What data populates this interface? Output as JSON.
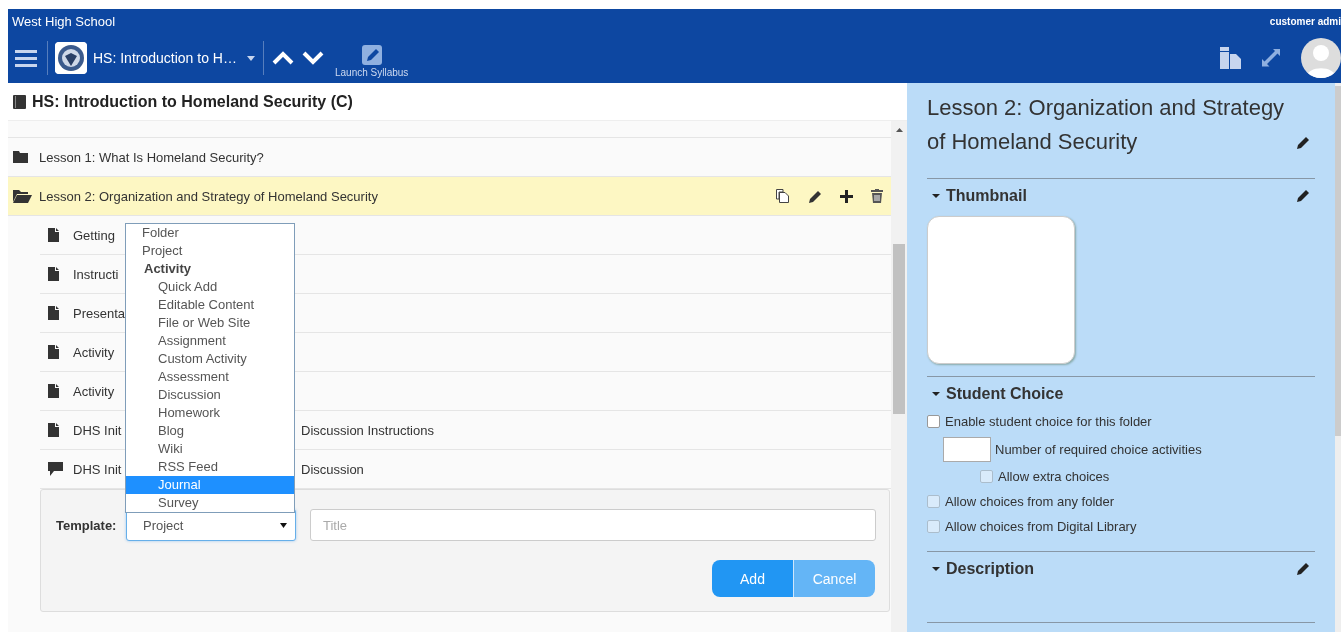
{
  "header": {
    "school": "West High School",
    "user": "customer admi",
    "course_title": "HS: Introduction to H…",
    "syllabus_label": "Launch Syllabus"
  },
  "outline": {
    "title": "HS: Introduction to Homeland Security (C)",
    "folders": [
      {
        "label": "Lesson 1: What Is Homeland Security?",
        "expanded": false,
        "selected": false
      },
      {
        "label": "Lesson 2: Organization and Strategy of Homeland Security",
        "expanded": true,
        "selected": true,
        "children": [
          {
            "kind": "page",
            "parts": [
              "Getting"
            ]
          },
          {
            "kind": "page",
            "parts": [
              "Instructi"
            ]
          },
          {
            "kind": "page",
            "parts": [
              "Presenta"
            ]
          },
          {
            "kind": "page",
            "parts": [
              "Activity"
            ]
          },
          {
            "kind": "page",
            "parts": [
              "Activity"
            ]
          },
          {
            "kind": "page",
            "parts": [
              "DHS Init",
              "Discussion Instructions"
            ]
          },
          {
            "kind": "discussion",
            "parts": [
              "DHS Init",
              "Discussion"
            ]
          }
        ]
      }
    ]
  },
  "template_menu": {
    "options": [
      {
        "kind": "option",
        "label": "Folder",
        "selected": false
      },
      {
        "kind": "option",
        "label": "Project",
        "selected": false
      },
      {
        "kind": "group",
        "label": "Activity",
        "options": [
          {
            "kind": "option",
            "label": "Quick Add",
            "selected": false
          },
          {
            "kind": "option",
            "label": "Editable Content",
            "selected": false
          },
          {
            "kind": "option",
            "label": "File or Web Site",
            "selected": false
          },
          {
            "kind": "option",
            "label": "Assignment",
            "selected": false
          },
          {
            "kind": "option",
            "label": "Custom Activity",
            "selected": false
          },
          {
            "kind": "option",
            "label": "Assessment",
            "selected": false
          },
          {
            "kind": "option",
            "label": "Discussion",
            "selected": false
          },
          {
            "kind": "option",
            "label": "Homework",
            "selected": false
          },
          {
            "kind": "option",
            "label": "Blog",
            "selected": false
          },
          {
            "kind": "option",
            "label": "Wiki",
            "selected": false
          },
          {
            "kind": "option",
            "label": "RSS Feed",
            "selected": false
          },
          {
            "kind": "option",
            "label": "Journal",
            "selected": true
          },
          {
            "kind": "option",
            "label": "Survey",
            "selected": false
          }
        ]
      }
    ]
  },
  "add_form": {
    "template_label": "Template:",
    "template_value": "Project",
    "title_placeholder": "Title",
    "buttons": [
      {
        "label": "Add",
        "kind": "primary"
      },
      {
        "label": "Cancel",
        "kind": "secondary"
      }
    ]
  },
  "details": {
    "title": "Lesson 2: Organization and Strategy of Homeland Security",
    "sections": [
      {
        "kind": "thumbnail",
        "heading": "Thumbnail",
        "expanded": true,
        "editable": true
      },
      {
        "kind": "choices",
        "heading": "Student Choice",
        "expanded": true,
        "editable": false,
        "options": [
          {
            "kind": "checkbox",
            "label": "Enable student choice for this folder",
            "checked": false,
            "disabled": false
          },
          {
            "kind": "number",
            "label": "Number of required choice activities"
          },
          {
            "kind": "sub-checkbox",
            "label": "Allow extra choices",
            "checked": false,
            "disabled": true
          },
          {
            "kind": "checkbox",
            "label": "Allow choices from any folder",
            "checked": false,
            "disabled": true
          },
          {
            "kind": "checkbox",
            "label": "Allow choices from Digital Library",
            "checked": false,
            "disabled": true
          }
        ]
      },
      {
        "kind": "text",
        "heading": "Description",
        "expanded": true,
        "editable": true
      }
    ]
  }
}
